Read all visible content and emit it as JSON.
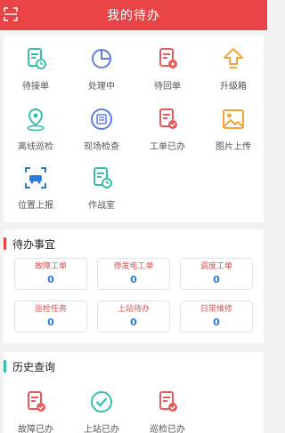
{
  "header": {
    "title": "我的待办"
  },
  "accent_color": "#e84445",
  "grid_items": [
    {
      "label": "待接单",
      "icon": "doc-clock-icon"
    },
    {
      "label": "处理中",
      "icon": "pie-chart-icon"
    },
    {
      "label": "待回单",
      "icon": "doc-return-icon"
    },
    {
      "label": "升级箱",
      "icon": "upgrade-arrow-icon"
    },
    {
      "label": "离线巡检",
      "icon": "location-pin-icon"
    },
    {
      "label": "现场检查",
      "icon": "inspect-circle-icon"
    },
    {
      "label": "工单已办",
      "icon": "doc-check-icon"
    },
    {
      "label": "图片上传",
      "icon": "image-icon"
    },
    {
      "label": "位置上报",
      "icon": "scan-car-icon"
    },
    {
      "label": "作战室",
      "icon": "doc-clock-icon"
    }
  ],
  "todo": {
    "title": "待办事宜",
    "items": [
      {
        "label": "故障工单",
        "value": "0"
      },
      {
        "label": "停发电工单",
        "value": "0"
      },
      {
        "label": "调度工单",
        "value": "0"
      },
      {
        "label": "巡检任务",
        "value": "0"
      },
      {
        "label": "上站待办",
        "value": "0"
      },
      {
        "label": "日常维修",
        "value": "0"
      }
    ]
  },
  "history": {
    "title": "历史查询",
    "items": [
      {
        "label": "故障已办",
        "icon": "doc-check-icon"
      },
      {
        "label": "上站已办",
        "icon": "check-circle-icon"
      },
      {
        "label": "巡检已办",
        "icon": "doc-check-icon"
      }
    ]
  }
}
